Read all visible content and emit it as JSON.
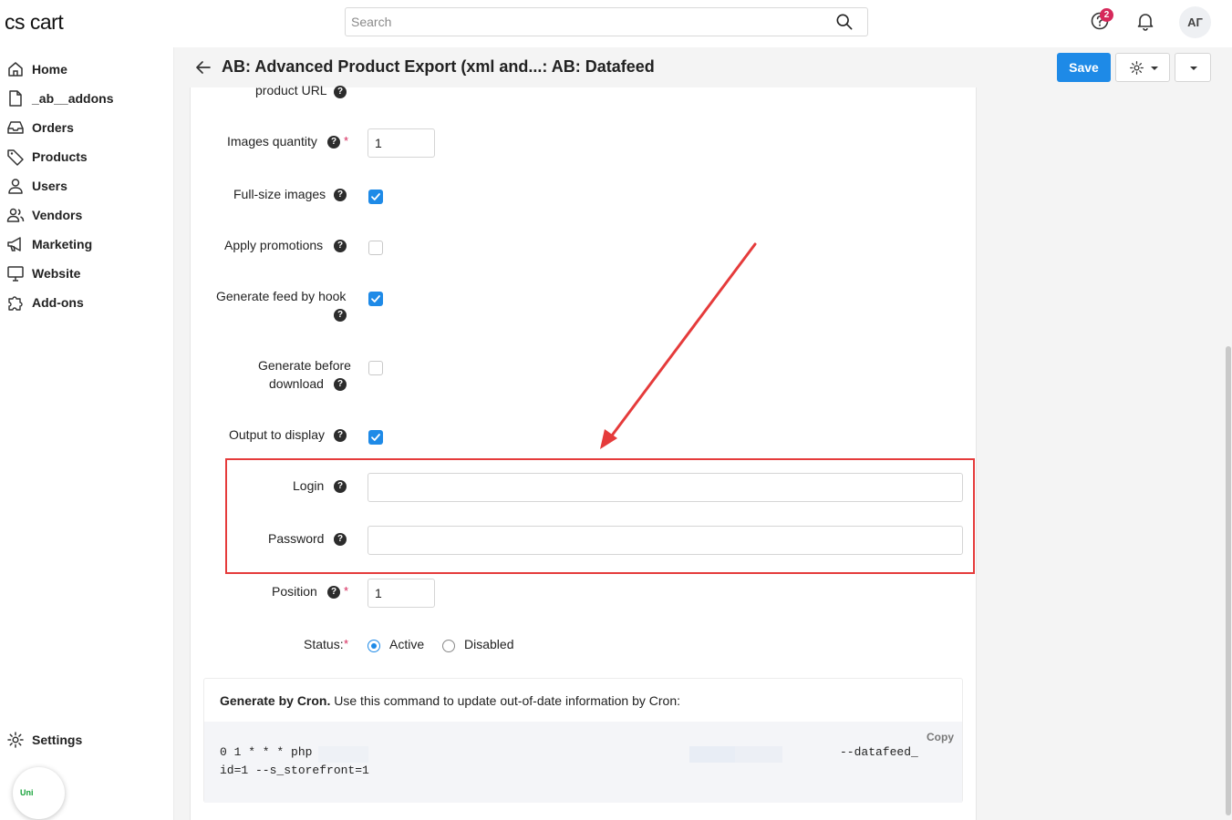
{
  "header": {
    "logo": "cs cart",
    "search_placeholder": "Search",
    "notifications_badge": "2",
    "avatar_initials": "АГ"
  },
  "sidebar": {
    "items": [
      {
        "label": "Home",
        "icon": "home-icon"
      },
      {
        "label": "_ab__addons",
        "icon": "file-icon"
      },
      {
        "label": "Orders",
        "icon": "inbox-icon"
      },
      {
        "label": "Products",
        "icon": "tag-icon"
      },
      {
        "label": "Users",
        "icon": "user-icon"
      },
      {
        "label": "Vendors",
        "icon": "users-icon"
      },
      {
        "label": "Marketing",
        "icon": "megaphone-icon"
      },
      {
        "label": "Website",
        "icon": "monitor-icon"
      },
      {
        "label": "Add-ons",
        "icon": "puzzle-icon"
      }
    ],
    "settings_label": "Settings",
    "widget_label": "Uni"
  },
  "titlebar": {
    "title": "AB: Advanced Product Export (xml and...: AB: Datafeed",
    "save_label": "Save"
  },
  "form": {
    "product_url_label": "product URL",
    "images_quantity": {
      "label": "Images quantity",
      "value": "1"
    },
    "full_size_images": {
      "label": "Full-size images",
      "checked": true
    },
    "apply_promotions": {
      "label": "Apply promotions",
      "checked": false
    },
    "generate_feed_by_hook": {
      "label": "Generate feed by hook",
      "checked": true
    },
    "generate_before_download": {
      "label_line1": "Generate before",
      "label_line2": "download",
      "checked": false
    },
    "output_to_display": {
      "label": "Output to display",
      "checked": true
    },
    "login": {
      "label": "Login",
      "value": ""
    },
    "password": {
      "label": "Password",
      "value": ""
    },
    "position": {
      "label": "Position",
      "value": "1"
    },
    "status": {
      "label": "Status:",
      "options": [
        "Active",
        "Disabled"
      ],
      "selected": "Active"
    }
  },
  "cron": {
    "heading_bold": "Generate by Cron.",
    "heading_rest": " Use this command to update out-of-date information by Cron:",
    "copy_label": "Copy",
    "line1_start": "0 1 * * * php",
    "line1_end": "--datafeed_",
    "line2": "id=1 --s_storefront=1"
  },
  "colors": {
    "accent": "#1e8ae7",
    "annotation": "#e53b3b",
    "badge": "#d6295b"
  }
}
